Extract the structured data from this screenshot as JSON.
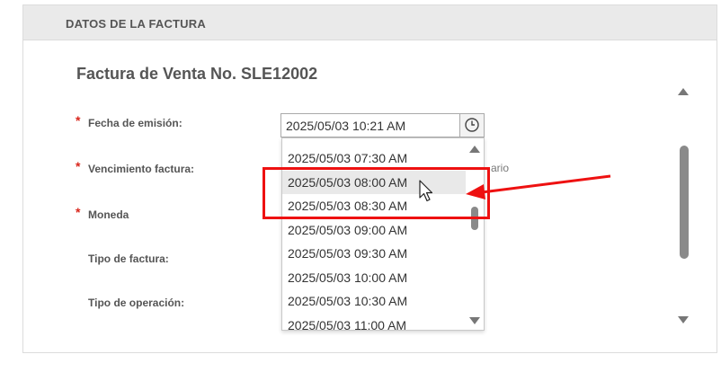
{
  "header": {
    "title": "DATOS DE LA FACTURA"
  },
  "invoice": {
    "title": "Factura de Venta No. SLE12002"
  },
  "fields": {
    "required_mark": "*",
    "fecha_emision": "Fecha de emisión:",
    "vencimiento": "Vencimiento factura:",
    "moneda": "Moneda",
    "tipo_factura": "Tipo de factura:",
    "tipo_operacion": "Tipo de operación:"
  },
  "time_input": {
    "value": "2025/05/03 10:21 AM",
    "icon": "clock-icon"
  },
  "hint": {
    "text": "ario"
  },
  "dropdown": {
    "options": [
      "2025/05/03 07:30 AM",
      "2025/05/03 08:00 AM",
      "2025/05/03 08:30 AM",
      "2025/05/03 09:00 AM",
      "2025/05/03 09:30 AM",
      "2025/05/03 10:00 AM",
      "2025/05/03 10:30 AM",
      "2025/05/03 11:00 AM"
    ],
    "hovered_option": "2025/05/03 08:00 AM"
  },
  "annotation": {
    "color": "#ee1111"
  },
  "colors": {
    "required": "#d9261c",
    "header_bg": "#eaeaea"
  }
}
